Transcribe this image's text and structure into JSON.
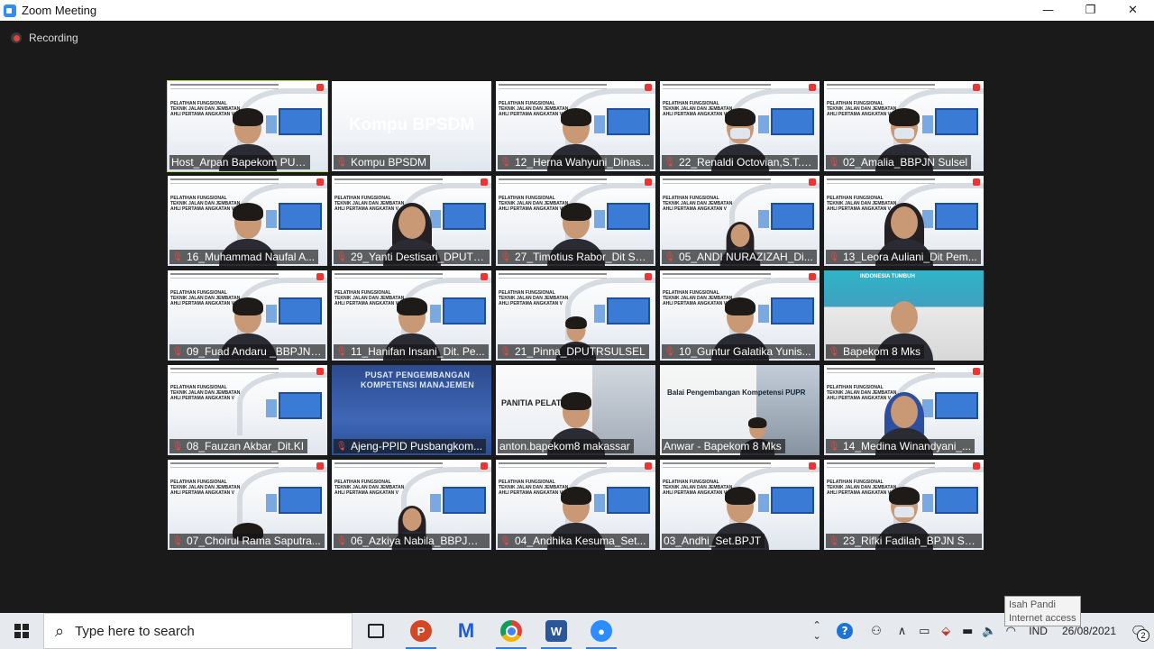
{
  "window": {
    "title": "Zoom Meeting",
    "minimize_glyph": "—",
    "restore_glyph": "❐",
    "close_glyph": "✕"
  },
  "meeting": {
    "recording_label": "Recording",
    "tiles": [
      {
        "name": "Host_Arpan Bapekom PUPR ...",
        "muted": false,
        "type": "slide",
        "active": true,
        "person": "man"
      },
      {
        "name": "Kompu BPSDM",
        "muted": true,
        "type": "kompu",
        "big_text": "Kompu BPSDM"
      },
      {
        "name": "12_Herna Wahyuni_Dinas...",
        "muted": true,
        "type": "slide",
        "person": "woman"
      },
      {
        "name": "22_Renaldi Octovian,S.T._...",
        "muted": true,
        "type": "slide",
        "person": "mask"
      },
      {
        "name": "02_Amalia_BBPJN Sulsel",
        "muted": true,
        "type": "slide",
        "person": "mask-woman"
      },
      {
        "name": "16_Muhammad Naufal A...",
        "muted": true,
        "type": "slide",
        "person": "man"
      },
      {
        "name": "29_Yanti Destisari_DPUTR...",
        "muted": true,
        "type": "slide",
        "person": "hijab"
      },
      {
        "name": "27_Timotius Rabor_Dit SS...",
        "muted": true,
        "type": "slide",
        "person": "man"
      },
      {
        "name": "05_ANDI NURAZIZAH_Di...",
        "muted": true,
        "type": "slide",
        "person": "hijab-small"
      },
      {
        "name": "13_Leora Auliani_Dit Pem...",
        "muted": true,
        "type": "slide",
        "person": "hijab"
      },
      {
        "name": "09_Fuad Andaru _BBPJN J...",
        "muted": true,
        "type": "slide",
        "person": "man"
      },
      {
        "name": "11_Hanifan Insani_Dit. Pe...",
        "muted": true,
        "type": "slide",
        "person": "man"
      },
      {
        "name": "21_Pinna_DPUTRSULSEL",
        "muted": true,
        "type": "slide",
        "person": "woman-small"
      },
      {
        "name": "10_Guntur Galatika Yunis...",
        "muted": true,
        "type": "slide",
        "person": "man"
      },
      {
        "name": "Bapekom 8 Mks",
        "muted": true,
        "type": "photo",
        "photo_tag": "INDONESIA TUMBUH"
      },
      {
        "name": "08_Fauzan Akbar_Dit.KI",
        "muted": true,
        "type": "slide",
        "person": "none"
      },
      {
        "name": "Ajeng-PPID Pusbangkom...",
        "muted": true,
        "type": "pusat",
        "banner": "PUSAT PENGEMBANGAN KOMPETENSI MANAJEMEN"
      },
      {
        "name": "anton.bapekom8 makassar",
        "muted": false,
        "type": "panitia",
        "banner": "PANITIA PELATIHAN"
      },
      {
        "name": "Anwar - Bapekom 8 Mks",
        "muted": false,
        "type": "anwar",
        "banner": "Balai Pengembangan Kompetensi PUPR"
      },
      {
        "name": "14_Medina Winandyani_...",
        "muted": true,
        "type": "slide",
        "person": "hijab-blue"
      },
      {
        "name": "07_Choirul Rama Saputra...",
        "muted": true,
        "type": "slide",
        "person": "hair-only"
      },
      {
        "name": "06_Azkiya Nabila_BBPJN J...",
        "muted": true,
        "type": "slide",
        "person": "hijab-small"
      },
      {
        "name": "04_Andhika Kesuma_Set...",
        "muted": true,
        "type": "slide",
        "person": "man"
      },
      {
        "name": "03_Andhi_Set.BPJT",
        "muted": false,
        "type": "slide",
        "person": "man"
      },
      {
        "name": "23_Rifki Fadilah_BPJN Sul...",
        "muted": true,
        "type": "slide",
        "person": "mask"
      }
    ],
    "slide_title": "PELATIHAN FUNGSIONAL TEKNIK JALAN DAN JEMBATAN AHLI PERTAMA ANGKATAN V",
    "muted_icon": "muted-mic-icon",
    "muted_glyph": "🎙"
  },
  "taskbar": {
    "search_placeholder": "Type here to search",
    "search_glyph": "⌕",
    "apps": [
      {
        "icon": "task-view-icon",
        "glyph": "",
        "running": false
      },
      {
        "icon": "powerpoint-icon",
        "glyph": "P",
        "running": true
      },
      {
        "icon": "m-app-icon",
        "glyph": "M",
        "running": false
      },
      {
        "icon": "chrome-icon",
        "glyph": "",
        "running": true
      },
      {
        "icon": "word-icon",
        "glyph": "W",
        "running": true
      },
      {
        "icon": "zoom-icon",
        "glyph": "●",
        "running": true
      }
    ],
    "tray": {
      "chevron_up": "⌃",
      "chevron_down": "⌄",
      "help": "?",
      "people": "⚇",
      "show_hidden": "∧",
      "lang": "IND",
      "time": "",
      "date": "26/08/2021",
      "notification_count": "2"
    },
    "tooltip": {
      "line1": "Isah Pandi",
      "line2": "Internet access"
    }
  }
}
